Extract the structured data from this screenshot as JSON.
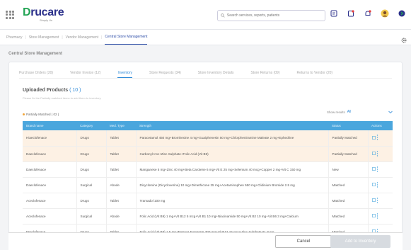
{
  "app": {
    "logo_text_d": "D",
    "logo_text_rest": "rucare",
    "logo_tagline": "Simply Us",
    "search_placeholder": "Search services, reports, patients"
  },
  "topbar_icons": [
    "note-icon",
    "clipboard-icon",
    "bell-icon",
    "avatar-icon",
    "logout-icon"
  ],
  "subnav": {
    "items": [
      {
        "label": "Pharmacy",
        "active": false
      },
      {
        "label": "Store Management",
        "active": false
      },
      {
        "label": "Vendor Management",
        "active": false
      },
      {
        "label": "Central Store Management",
        "active": true
      }
    ]
  },
  "page_title": "Central Store Management",
  "tabs": [
    {
      "label": "Purchase Orders (20)",
      "active": false
    },
    {
      "label": "Vendor Invoice (12)",
      "active": false
    },
    {
      "label": "Inventory",
      "active": true
    },
    {
      "label": "Store Requests (34)",
      "active": false
    },
    {
      "label": "Store Inventory Details",
      "active": false
    },
    {
      "label": "Store Returns (09)",
      "active": false
    },
    {
      "label": "Returns to Vendor (20)",
      "active": false
    }
  ],
  "uploaded": {
    "title": "Uploaded Products",
    "count": "( 10 )",
    "subtitle": "Please fix the Partially matched items to add them to inventory."
  },
  "legend": {
    "label": "Partially Matched ( 02 )",
    "color": "#f1a63c"
  },
  "show_results": {
    "label": "Show results",
    "value": "All"
  },
  "table": {
    "headers": [
      "Brand name",
      "Category",
      "Med. Type",
      "Strength",
      "Status",
      "Actions"
    ],
    "rows": [
      {
        "brand": "Hiaeclofenace",
        "category": "Drugs",
        "type": "Tablet",
        "strength": "Paracetamol 450 mg+Bromhexine 4 mg+Guaiphenesin 50 mg+Chlorpheniramine Maleate 2 mg+Ephedrine",
        "status": "Partially Matched",
        "highlight": true
      },
      {
        "brand": "Daeclofenace",
        "category": "Drugs",
        "type": "Tablet",
        "strength": "Carbonyl Iron+Zinc Sulphate+Folic Acid (Vit B9)",
        "status": "Partially Matched",
        "highlight": true
      },
      {
        "brand": "Daeclofenace",
        "category": "Drugs",
        "type": "Tablet",
        "strength": "Manganese 5 mg+Zinc 40 mg+Beta Carotene 6 mg+Vit E 25 mg+Selenium 40 mcg+Copper 2 mg+Vit C 150 mg",
        "status": "New",
        "highlight": false
      },
      {
        "brand": "Daeclofenace",
        "category": "Surgical",
        "type": "Abode",
        "strength": "Dicyclomine (Dicycloverine) 10 mg+Dimethicone 25 mg+Acetaminophen 550 mg+Clidinium Bromide 2.5 mg",
        "status": "Matched",
        "highlight": false
      },
      {
        "brand": "Aceclofenace",
        "category": "Drugs",
        "type": "Tablet",
        "strength": "Tramadol 100 mg",
        "status": "Matched",
        "highlight": false
      },
      {
        "brand": "Aceclofenace",
        "category": "Surgical",
        "type": "Abode",
        "strength": "Folic Acid (Vit B9) 1 mg+Vit B12 5 mcg+Vit B1 10 mg+Niacinamide 50 mg+Vit B2 10 mg+Vit B6 3 mg+Calcium",
        "status": "Matched",
        "highlight": false
      },
      {
        "brand": "Fseclofenace",
        "category": "Drugs",
        "type": "Tablet",
        "strength": "Folic Acid (Vit B9) 1.5 mg+Ferrous Fumarate 300 mg+Vit B12 15 mcg+Zinc Sulphate 61.8 mg",
        "status": "Matched",
        "highlight": false
      }
    ]
  },
  "footer": {
    "cancel_label": "Cancel",
    "add_label": "Add to Inventory"
  }
}
